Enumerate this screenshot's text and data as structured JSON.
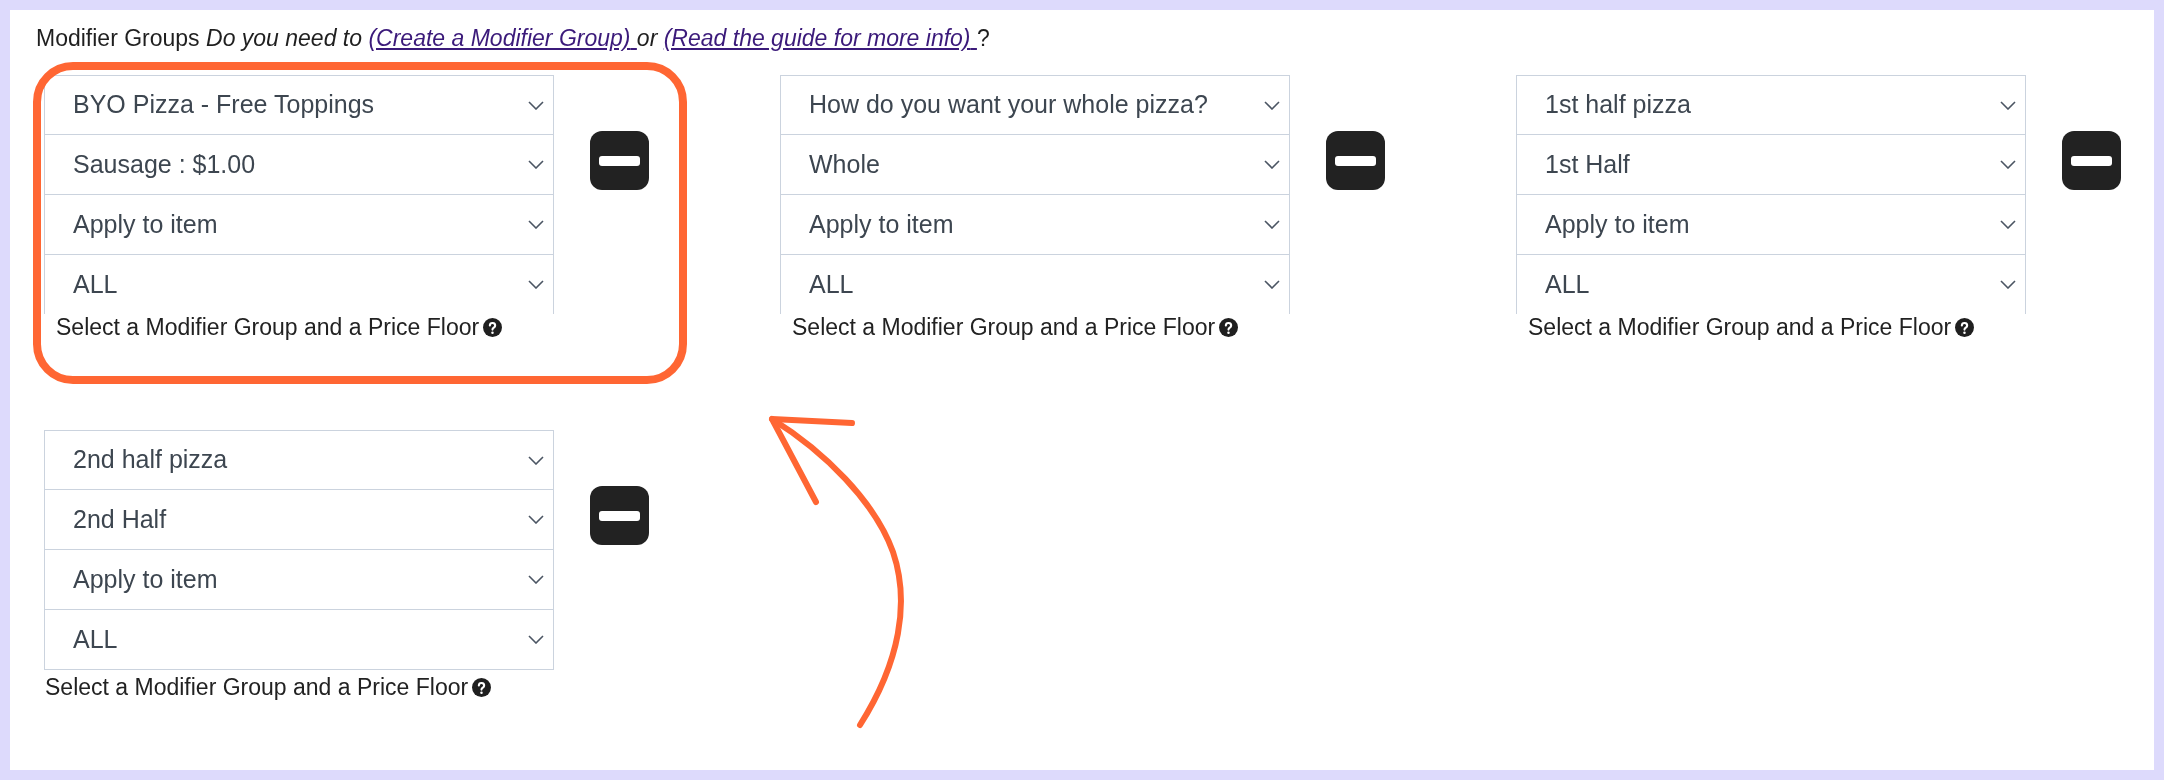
{
  "intro": {
    "title": "Modifier Groups",
    "question": "Do you need to",
    "links": [
      {
        "label": "(Create a Modifier Group)"
      },
      {
        "label": "(Read the guide for more info)"
      }
    ],
    "conjunction": "or",
    "end": "?"
  },
  "modifier_groups": [
    {
      "highlighted": true,
      "selects": [
        "BYO Pizza - Free Toppings",
        "Sausage : $1.00",
        "Apply to item",
        "ALL"
      ],
      "hint": "Select a Modifier Group and a Price Floor"
    },
    {
      "highlighted": false,
      "selects": [
        "How do you want your whole pizza?",
        "Whole",
        "Apply to item",
        "ALL"
      ],
      "hint": "Select a Modifier Group and a Price Floor"
    },
    {
      "highlighted": false,
      "selects": [
        "1st half pizza",
        "1st Half",
        "Apply to item",
        "ALL"
      ],
      "hint": "Select a Modifier Group and a Price Floor"
    },
    {
      "highlighted": false,
      "selects": [
        "2nd half pizza",
        "2nd Half",
        "Apply to item",
        "ALL"
      ],
      "hint": "Select a Modifier Group and a Price Floor"
    }
  ]
}
